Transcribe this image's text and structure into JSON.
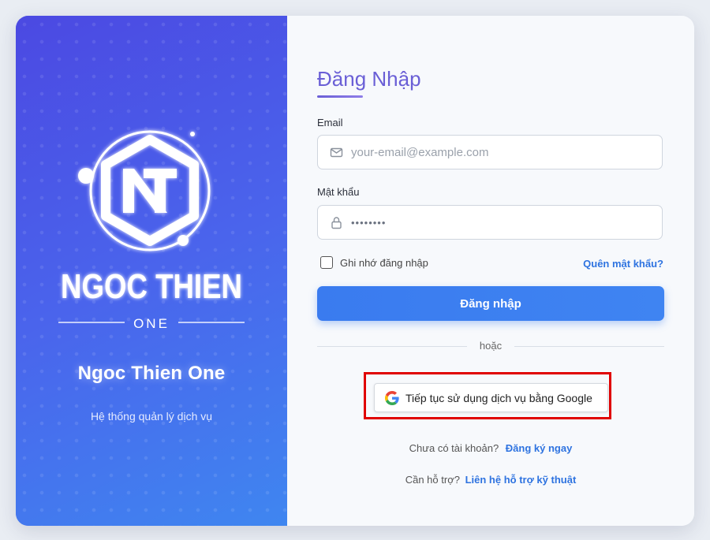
{
  "brand": {
    "logo_wordmark": "NGOC THIEN",
    "logo_subword": "ONE",
    "name": "Ngoc Thien One",
    "tagline": "Hệ thống quản lý dịch vụ"
  },
  "login": {
    "title": "Đăng Nhập",
    "email_label": "Email",
    "email_placeholder": "your-email@example.com",
    "email_value": "",
    "password_label": "Mật khẩu",
    "password_value": "••••••••",
    "remember_label": "Ghi nhớ đăng nhập",
    "remember_checked": false,
    "forgot_link": "Quên mật khẩu?",
    "submit_label": "Đăng nhập",
    "divider_text": "hoặc",
    "google_label": "Tiếp tục sử dụng dịch vụ bằng Google",
    "no_account_text": "Chưa có tài khoản?",
    "signup_link": "Đăng ký ngay",
    "support_text": "Cần hỗ trợ?",
    "support_link": "Liên hệ hỗ trợ kỹ thuật"
  },
  "icons": {
    "email": "envelope-icon",
    "password": "lock-icon",
    "google": "google-logo-icon"
  },
  "colors": {
    "panel_gradient_start": "#4b49e2",
    "panel_gradient_end": "#3f86f0",
    "title": "#6a5fd6",
    "primary_button": "#3a7bef",
    "link": "#2e73e0",
    "highlight_border": "#e00000"
  }
}
